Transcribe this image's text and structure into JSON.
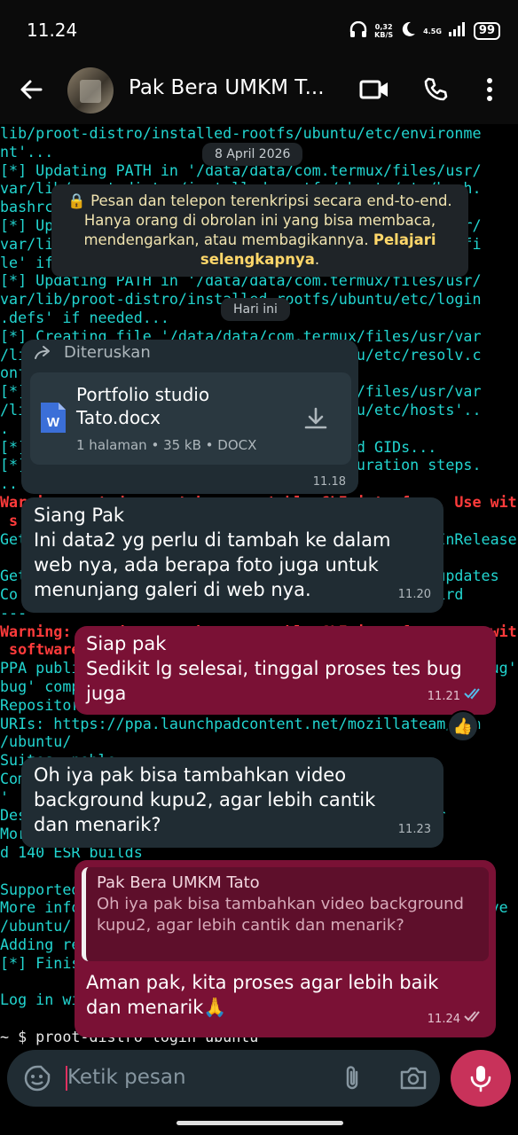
{
  "status_bar": {
    "time": "11.24",
    "net_speed": "0,32",
    "net_unit": "KB/S",
    "network": "4.5G",
    "battery": "99"
  },
  "header": {
    "contact_name": "Pak Bera UMKM T...",
    "icons": [
      "back-arrow-icon",
      "video-call-icon",
      "phone-icon",
      "more-vert-icon"
    ]
  },
  "wallpaper_terminal": {
    "lines": [
      "lib/proot-distro/installed-rootfs/ubuntu/etc/environme",
      "nt'...",
      "[*] Updating PATH in '/data/data/com.termux/files/usr/",
      "var/lib/proot-distro/installed-rootfs/ubuntu/etc/bash.",
      "bashrc'...",
      "[*] Updating PATH in '/data/data/com.termux/files/usr/",
      "var/lib/proot-distro/installed-rootfs/ubuntu/etc/profi",
      "le' if needed...",
      "[*] Updating PATH in '/data/data/com.termux/files/usr/",
      "var/lib/proot-distro/installed-rootfs/ubuntu/etc/login",
      ".defs' if needed...",
      "[*] Creating file '/data/data/com.termux/files/usr/var",
      "/lib/proot-distro/installed-rootfs/ubuntu/etc/resolv.c",
      "onf'...",
      "[*] Creating file '/data/data/com.termux/files/usr/var",
      "/lib/proot-distro/installed-rootfs/ubuntu/etc/hosts'..",
      ".",
      "[*] Registering Android-specific UIDs and GIDs...",
      "[*] Running distribution-specific configuration steps.",
      "..",
      "Warning: apt does not have a stable CLI interface. Use with caution in scripts, some",
      " s",
      "Get:1 http://ports.ubuntu.com/ubuntu-ports noble InRelease",
      "",
      "Get:2 http://ports.ubuntu.com/ubuntu-ports noble-updates",
      "Co    ppa for Mozilla Thunderbird            derbird",
      "---",
      "Warning: apt does not have a stable CLI interface, use with caution in scripts, some",
      " software",
      "PPA publishes dbgsym, you may need to include 'main/debug' component to de",
      "bug' component",
      "Repository: 'Types: deb",
      "URIs: https://ppa.launchpadcontent.net/mozillateam/ppa",
      "/ubuntu/",
      "Suites: noble",
      "Components: main",
      "'",
      "Description: Mozilla Team's Firefox and Thunderbir",
      "More info: Firefox ESR and Thunderbird Thunderbir",
      "d 140 ESR builds",
      "",
      "Supported: noble",
      "More info: https://launchpad.net/~mozillateam/+archive/ve",
      "/ubuntu/",
      "Adding repository.",
      "[*] Finished.",
      "",
      "Log in with: proot-distro login ubuntu",
      "",
      "~ $ proot-distro login ubuntu"
    ]
  },
  "chat": {
    "date_chip": "8 April 2026",
    "encryption_notice": "Pesan dan telepon terenkripsi secara end-to-end. Hanya orang di obrolan ini yang bisa membaca, mendengarkan, atau membagikannya.",
    "encryption_link": "Pelajari selengkapnya",
    "today_chip": "Hari ini",
    "forwarded_label": "Diteruskan",
    "document": {
      "name": "Portfolio studio Tato.docx",
      "meta": "1 halaman • 35 kB • DOCX",
      "type_letter": "W",
      "time": "11.18"
    },
    "messages": [
      {
        "direction": "in",
        "text": "Siang Pak\nIni data2 yg perlu di tambah ke dalam web nya, ada berapa foto juga untuk menunjang galeri di web nya.",
        "time": "11.20"
      },
      {
        "direction": "out",
        "text": "Siap pak\nSedikit lg selesai, tinggal proses tes bug juga",
        "time": "11.21",
        "status": "read",
        "reaction": "👍"
      },
      {
        "direction": "in",
        "text": "Oh iya pak bisa tambahkan video background kupu2, agar lebih cantik dan menarik?",
        "time": "11.23"
      },
      {
        "direction": "out",
        "text": "Aman pak, kita proses agar lebih baik dan menarik🙏",
        "time": "11.24",
        "status": "delivered",
        "reply_to": {
          "name": "Pak Bera UMKM Tato",
          "text": "Oh iya pak bisa tambahkan video background kupu2, agar lebih cantik dan menarik?"
        }
      }
    ]
  },
  "composer": {
    "placeholder": "Ketik pesan"
  },
  "colors": {
    "incoming_bubble": "#202c33",
    "outgoing_bubble": "#7a1135",
    "mic_button": "#c8325a",
    "terminal_text": "#22d5d0",
    "read_ticks": "#53bdeb"
  }
}
